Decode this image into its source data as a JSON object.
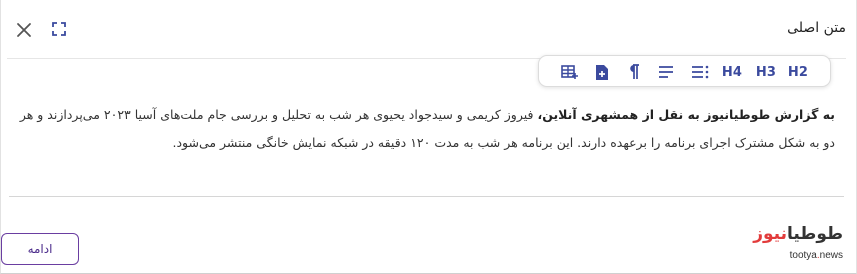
{
  "header": {
    "title": "متن اصلی"
  },
  "icons": {
    "close": "close-icon",
    "expand": "expand-icon"
  },
  "toolbar": {
    "items": [
      {
        "icon": "insert-table-icon"
      },
      {
        "icon": "add-file-icon"
      },
      {
        "icon": "paragraph-icon"
      },
      {
        "icon": "align-right-icon"
      },
      {
        "icon": "list-options-icon"
      },
      {
        "label": "H4"
      },
      {
        "label": "H3"
      },
      {
        "label": "H2"
      }
    ]
  },
  "article": {
    "lead_bold": "به گزارش طوطیانیوز به نقل از همشهری آنلاین،",
    "body": " فیروز کریمی و سیدجواد یحیوی هر شب به تحلیل و بررسی جام ملت‌های آسیا ۲۰۲۳ می‌پردازند و هر دو به شکل مشترک اجرای برنامه را برعهده دارند. این برنامه هر شب به مدت ۱۲۰ دقیقه در شبکه نمایش خانگی منتشر می‌شود."
  },
  "footer": {
    "continue_label": "ادامه",
    "logo_part1": "طوطیا",
    "logo_part2": "نیوز",
    "logo_sub_a": "tootya",
    "logo_sub_dot": ".",
    "logo_sub_b": "news"
  },
  "colors": {
    "accent": "#3b4a9e",
    "button_border": "#6a3ea1",
    "logo_red": "#e23b3b"
  }
}
